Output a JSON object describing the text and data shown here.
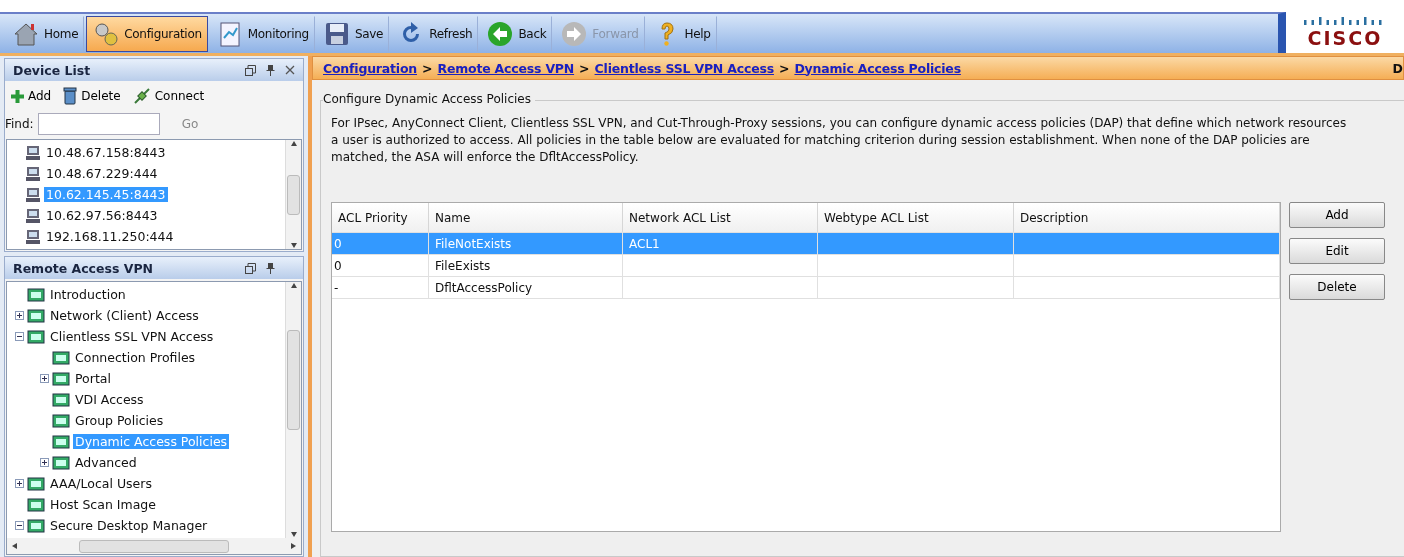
{
  "toolbar": {
    "buttons": [
      {
        "label": "Home",
        "selected": false,
        "disabled": false
      },
      {
        "label": "Configuration",
        "selected": true,
        "disabled": false
      },
      {
        "label": "Monitoring",
        "selected": false,
        "disabled": false
      },
      {
        "label": "Save",
        "selected": false,
        "disabled": false
      },
      {
        "label": "Refresh",
        "selected": false,
        "disabled": false
      },
      {
        "label": "Back",
        "selected": false,
        "disabled": false
      },
      {
        "label": "Forward",
        "selected": false,
        "disabled": true
      },
      {
        "label": "Help",
        "selected": false,
        "disabled": false
      }
    ],
    "logo": "CISCO"
  },
  "device_list": {
    "title": "Device List",
    "actions": [
      "Add",
      "Delete",
      "Connect"
    ],
    "find_label": "Find:",
    "go": "Go",
    "items": [
      {
        "label": "10.48.67.158:8443",
        "selected": false
      },
      {
        "label": "10.48.67.229:444",
        "selected": false
      },
      {
        "label": "10.62.145.45:8443",
        "selected": true
      },
      {
        "label": "10.62.97.56:8443",
        "selected": false
      },
      {
        "label": "192.168.11.250:444",
        "selected": false
      }
    ]
  },
  "nav": {
    "title": "Remote Access VPN",
    "items": [
      {
        "label": "Introduction",
        "selected": false
      },
      {
        "label": "Network (Client) Access",
        "selected": false,
        "expanded": false
      },
      {
        "label": "Clientless SSL VPN Access",
        "selected": false,
        "expanded": true,
        "children": [
          {
            "label": "Connection Profiles",
            "selected": false
          },
          {
            "label": "Portal",
            "selected": false,
            "expanded": false
          },
          {
            "label": "VDI Access",
            "selected": false
          },
          {
            "label": "Group Policies",
            "selected": false
          },
          {
            "label": "Dynamic Access Policies",
            "selected": true
          },
          {
            "label": "Advanced",
            "selected": false,
            "expanded": false
          }
        ]
      },
      {
        "label": "AAA/Local Users",
        "selected": false,
        "expanded": false
      },
      {
        "label": "Host Scan Image",
        "selected": false
      },
      {
        "label": "Secure Desktop Manager",
        "selected": false,
        "expanded": true
      }
    ]
  },
  "breadcrumb": {
    "links": [
      "Configuration",
      "Remote Access VPN",
      "Clientless SSL VPN Access",
      "Dynamic Access Policies"
    ],
    "separator": ">",
    "edge_text": "D"
  },
  "group": {
    "title": "Configure Dynamic Access Policies",
    "description": "For IPsec, AnyConnect Client, Clientless SSL VPN, and Cut-Through-Proxy sessions, you can configure dynamic access policies (DAP) that define which network resources a user is authorized to access. All policies in the table below are evaluated for matching criterion during session establishment. When none of the DAP policies are matched, the ASA will enforce the DfltAccessPolicy."
  },
  "table": {
    "columns": [
      "ACL Priority",
      "Name",
      "Network ACL List",
      "Webtype ACL List",
      "Description"
    ],
    "rows": [
      {
        "cells": [
          "0",
          "FileNotExists",
          "ACL1",
          "",
          ""
        ],
        "selected": true
      },
      {
        "cells": [
          "0",
          "FileExists",
          "",
          "",
          ""
        ],
        "selected": false
      },
      {
        "cells": [
          "-",
          "DfltAccessPolicy",
          "",
          "",
          ""
        ],
        "selected": false
      }
    ]
  },
  "buttons": [
    "Add",
    "Edit",
    "Delete"
  ]
}
